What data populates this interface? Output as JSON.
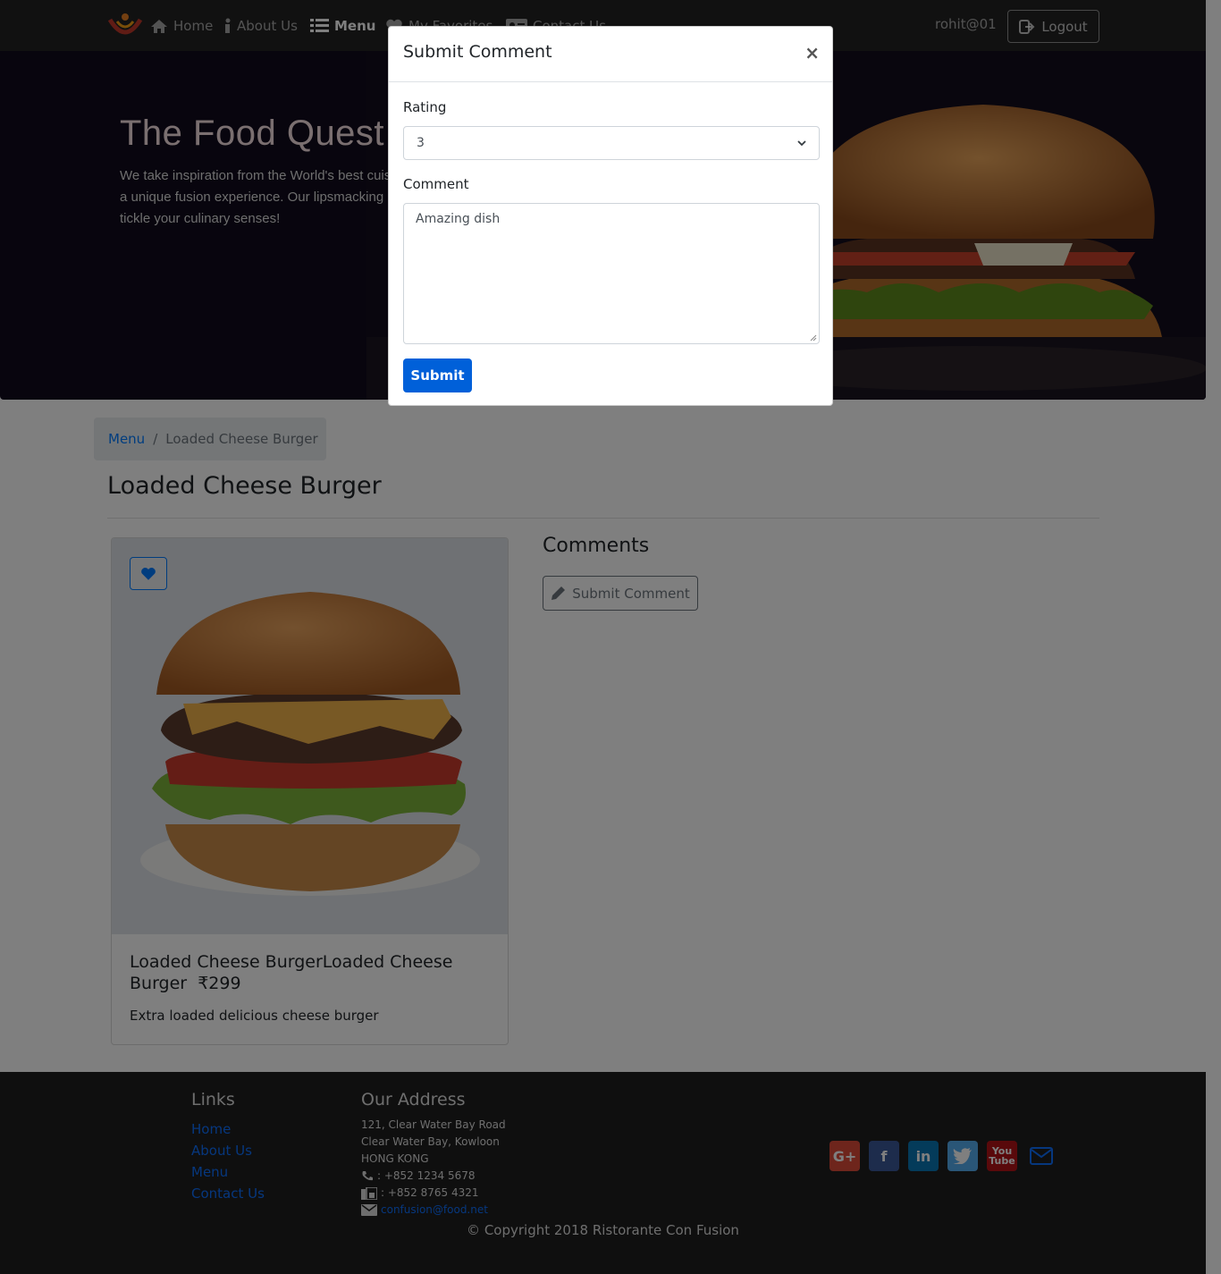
{
  "navbar": {
    "links": [
      {
        "label": "Home",
        "icon": "home-icon"
      },
      {
        "label": "About Us",
        "icon": "info-icon"
      },
      {
        "label": "Menu",
        "icon": "list-icon",
        "active": true
      },
      {
        "label": "My Favorites",
        "icon": "heart-icon"
      },
      {
        "label": "Contact Us",
        "icon": "address-card-icon"
      }
    ],
    "username": "rohit@01",
    "logout_label": "Logout"
  },
  "hero": {
    "title": "The Food Quest",
    "text": "We take inspiration from the World's best cuisines, and create a unique fusion experience. Our lipsmacking creations will tickle your culinary senses!"
  },
  "breadcrumb": {
    "menu_label": "Menu",
    "current": "Loaded Cheese Burger"
  },
  "page": {
    "title": "Loaded Cheese Burger"
  },
  "dish": {
    "name": "Loaded Cheese BurgerLoaded Cheese Burger",
    "price": "₹299",
    "description": "Extra loaded delicious cheese burger"
  },
  "comments": {
    "title": "Comments",
    "button_label": "Submit Comment"
  },
  "footer": {
    "links_title": "Links",
    "links": [
      "Home",
      "About Us",
      "Menu",
      "Contact Us"
    ],
    "address_title": "Our Address",
    "address_lines": [
      "121, Clear Water Bay Road",
      "Clear Water Bay, Kowloon",
      "HONG KONG"
    ],
    "phone": ": +852 1234 5678",
    "fax": ": +852 8765 4321",
    "email": "confusion@food.net",
    "social_icons": [
      "google-plus-icon",
      "facebook-icon",
      "linkedin-icon",
      "twitter-icon",
      "youtube-icon",
      "envelope-icon"
    ],
    "copyright": "© Copyright 2018 Ristorante Con Fusion"
  },
  "modal": {
    "title": "Submit Comment",
    "close": "×",
    "rating_label": "Rating",
    "rating_value": "3",
    "comment_label": "Comment",
    "comment_value": "Amazing dish",
    "submit_label": "Submit"
  },
  "colors": {
    "primary": "#007bff",
    "navbar": "#222222",
    "footer": "#1f1f1f",
    "submit": "#0060d9"
  }
}
